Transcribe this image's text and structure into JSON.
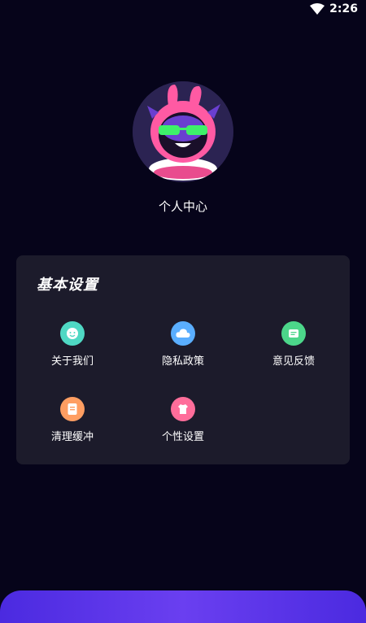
{
  "status_bar": {
    "time": "2:26",
    "wifi_icon": "wifi-icon"
  },
  "profile": {
    "avatar_icon": "cartoon-avatar",
    "title": "个人中心"
  },
  "settings": {
    "title": "基本设置",
    "items": [
      {
        "label": "关于我们",
        "icon": "smiley-icon",
        "color": "#4fd8c4"
      },
      {
        "label": "隐私政策",
        "icon": "cloud-icon",
        "color": "#5aaeff"
      },
      {
        "label": "意见反馈",
        "icon": "message-icon",
        "color": "#4cd68a"
      },
      {
        "label": "清理缓冲",
        "icon": "document-icon",
        "color": "#ff9e62"
      },
      {
        "label": "个性设置",
        "icon": "shirt-icon",
        "color": "#ff6d9a"
      }
    ]
  },
  "colors": {
    "background": "#06041a",
    "card": "#1c1b2b",
    "accent": "#5b36e8"
  }
}
